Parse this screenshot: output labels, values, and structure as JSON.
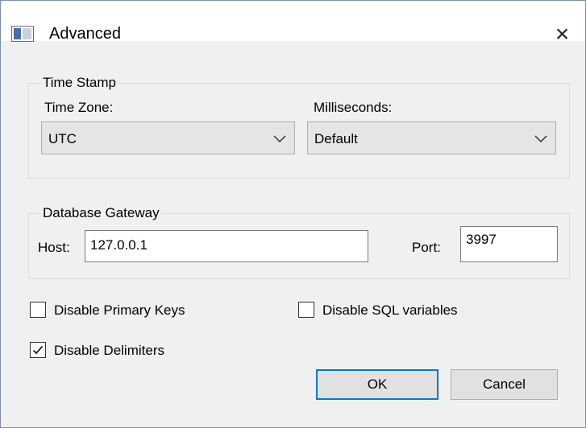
{
  "window": {
    "title": "Advanced",
    "close_glyph": "×",
    "app_icon": "window-icon"
  },
  "timestamp_group": {
    "label": "Time Stamp",
    "timezone_label": "Time Zone:",
    "timezone_value": "UTC",
    "milliseconds_label": "Milliseconds:",
    "milliseconds_value": "Default"
  },
  "gateway_group": {
    "label": "Database Gateway",
    "host_label": "Host:",
    "host_value": "127.0.0.1",
    "port_label": "Port:",
    "port_value": "3997"
  },
  "options": {
    "disable_primary_keys": {
      "label": "Disable Primary Keys",
      "checked": false
    },
    "disable_sql_variables": {
      "label": "Disable SQL variables",
      "checked": false
    },
    "disable_delimiters": {
      "label": "Disable Delimiters",
      "checked": true
    }
  },
  "buttons": {
    "ok": "OK",
    "cancel": "Cancel"
  },
  "colors": {
    "accent": "#0078d7",
    "background": "#f0f0f0",
    "combo_bg": "#e5e5e5"
  }
}
